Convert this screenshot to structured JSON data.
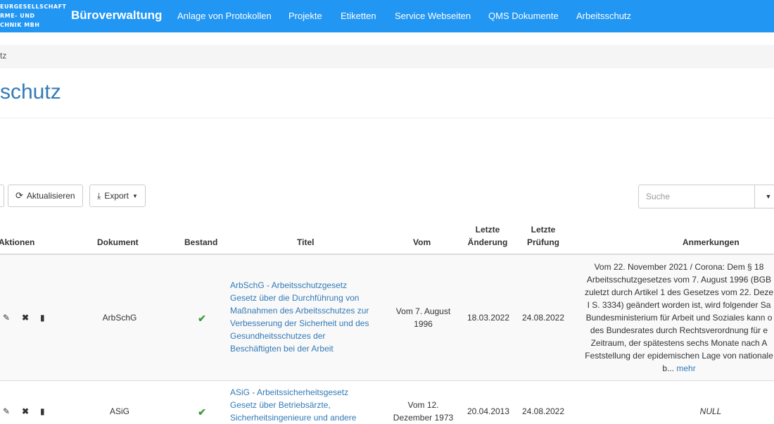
{
  "navbar": {
    "logo_text": "EURGESELLSCHAFT\nRME- UND\nCHNIK MBH",
    "brand": "Büroverwaltung",
    "links": [
      "Anlage von Protokollen",
      "Projekte",
      "Etiketten",
      "Service Webseiten",
      "QMS Dokumente",
      "Arbeitsschutz"
    ],
    "color": "#2196f3"
  },
  "breadcrumb": "tz",
  "page_title": "schutz",
  "toolbar": {
    "refresh_label": "Aktualisieren",
    "export_label": "Export",
    "search_placeholder": "Suche"
  },
  "table": {
    "headers": {
      "aktionen": "Aktionen",
      "dokument": "Dokument",
      "bestand": "Bestand",
      "titel": "Titel",
      "vom": "Vom",
      "letzte_aenderung": [
        "Letzte",
        "Änderung"
      ],
      "letzte_pruefung": [
        "Letzte",
        "Prüfung"
      ],
      "anmerkungen": "Anmerkungen"
    },
    "rows": [
      {
        "dokument": "ArbSchG",
        "bestand": "✔",
        "titel_lines": [
          "ArbSchG - Arbeitsschutzgesetz",
          "Gesetz über die Durchführung von",
          "Maßnahmen des Arbeitsschutzes zur",
          "Verbesserung der Sicherheit und des",
          "Gesundheitsschutzes der",
          "Beschäftigten bei der Arbeit"
        ],
        "vom_lines": [
          "Vom 7. August",
          "1996"
        ],
        "letzte_aenderung": "18.03.2022",
        "letzte_pruefung": "24.08.2022",
        "anmerkungen_lines": [
          "Vom 22. November 2021 / Corona: Dem § 18",
          "Arbeitsschutzgesetzes vom 7. August 1996 (BGB",
          "zuletzt durch Artikel 1 des Gesetzes vom 22. Deze",
          "I S. 3334) geändert worden ist, wird folgender Sa",
          "Bundesministerium für Arbeit und Soziales kann o",
          "des Bundesrates durch Rechtsverordnung für e",
          "Zeitraum, der spätestens sechs Monate nach A",
          "Feststellung der epidemischen Lage von nationale"
        ],
        "anmerkungen_tail": "b...",
        "mehr_label": "mehr"
      },
      {
        "dokument": "ASiG",
        "bestand": "✔",
        "titel_lines": [
          "ASiG - Arbeitssicherheitsgesetz",
          "Gesetz über Betriebsärzte,",
          "Sicherheitsingenieure und andere"
        ],
        "vom_lines": [
          "Vom 12.",
          "Dezember 1973"
        ],
        "letzte_aenderung": "20.04.2013",
        "letzte_pruefung": "24.08.2022",
        "anmerkungen": "NULL"
      }
    ]
  }
}
